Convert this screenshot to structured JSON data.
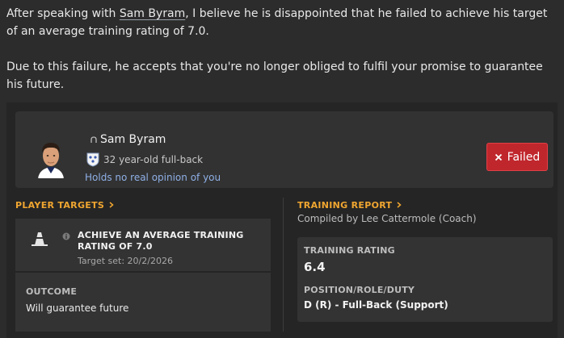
{
  "message": {
    "p1_before": "After speaking with ",
    "player_link": "Sam Byram",
    "p1_after": ", I believe he is disappointed that he failed to achieve his target of an average training rating of 7.0.",
    "p2": "Due to this failure, he accepts that you're no longer obliged to fulfil your promise to guarantee his future."
  },
  "player": {
    "name": "Sam Byram",
    "description": "32 year-old full-back",
    "opinion": "Holds no real opinion of you",
    "status_label": "Failed",
    "icons": {
      "name": "person-status-icon",
      "flag": "england-crest-icon"
    }
  },
  "player_targets": {
    "title": "PLAYER TARGETS",
    "target": "ACHIEVE AN AVERAGE TRAINING RATING OF 7.0",
    "target_set": "Target set: 20/2/2026",
    "outcome_label": "OUTCOME",
    "outcome_value": "Will guarantee future"
  },
  "training_report": {
    "title": "TRAINING REPORT",
    "compiled_by": "Compiled by Lee Cattermole (Coach)",
    "rating_label": "TRAINING RATING",
    "rating_value": "6.4",
    "position_label": "POSITION/ROLE/DUTY",
    "position_value": "D (R) - Full-Back (Support)"
  },
  "colors": {
    "accent_orange": "#f0a630",
    "failed_red": "#c0272d",
    "link_blue": "#8fb0e6"
  }
}
